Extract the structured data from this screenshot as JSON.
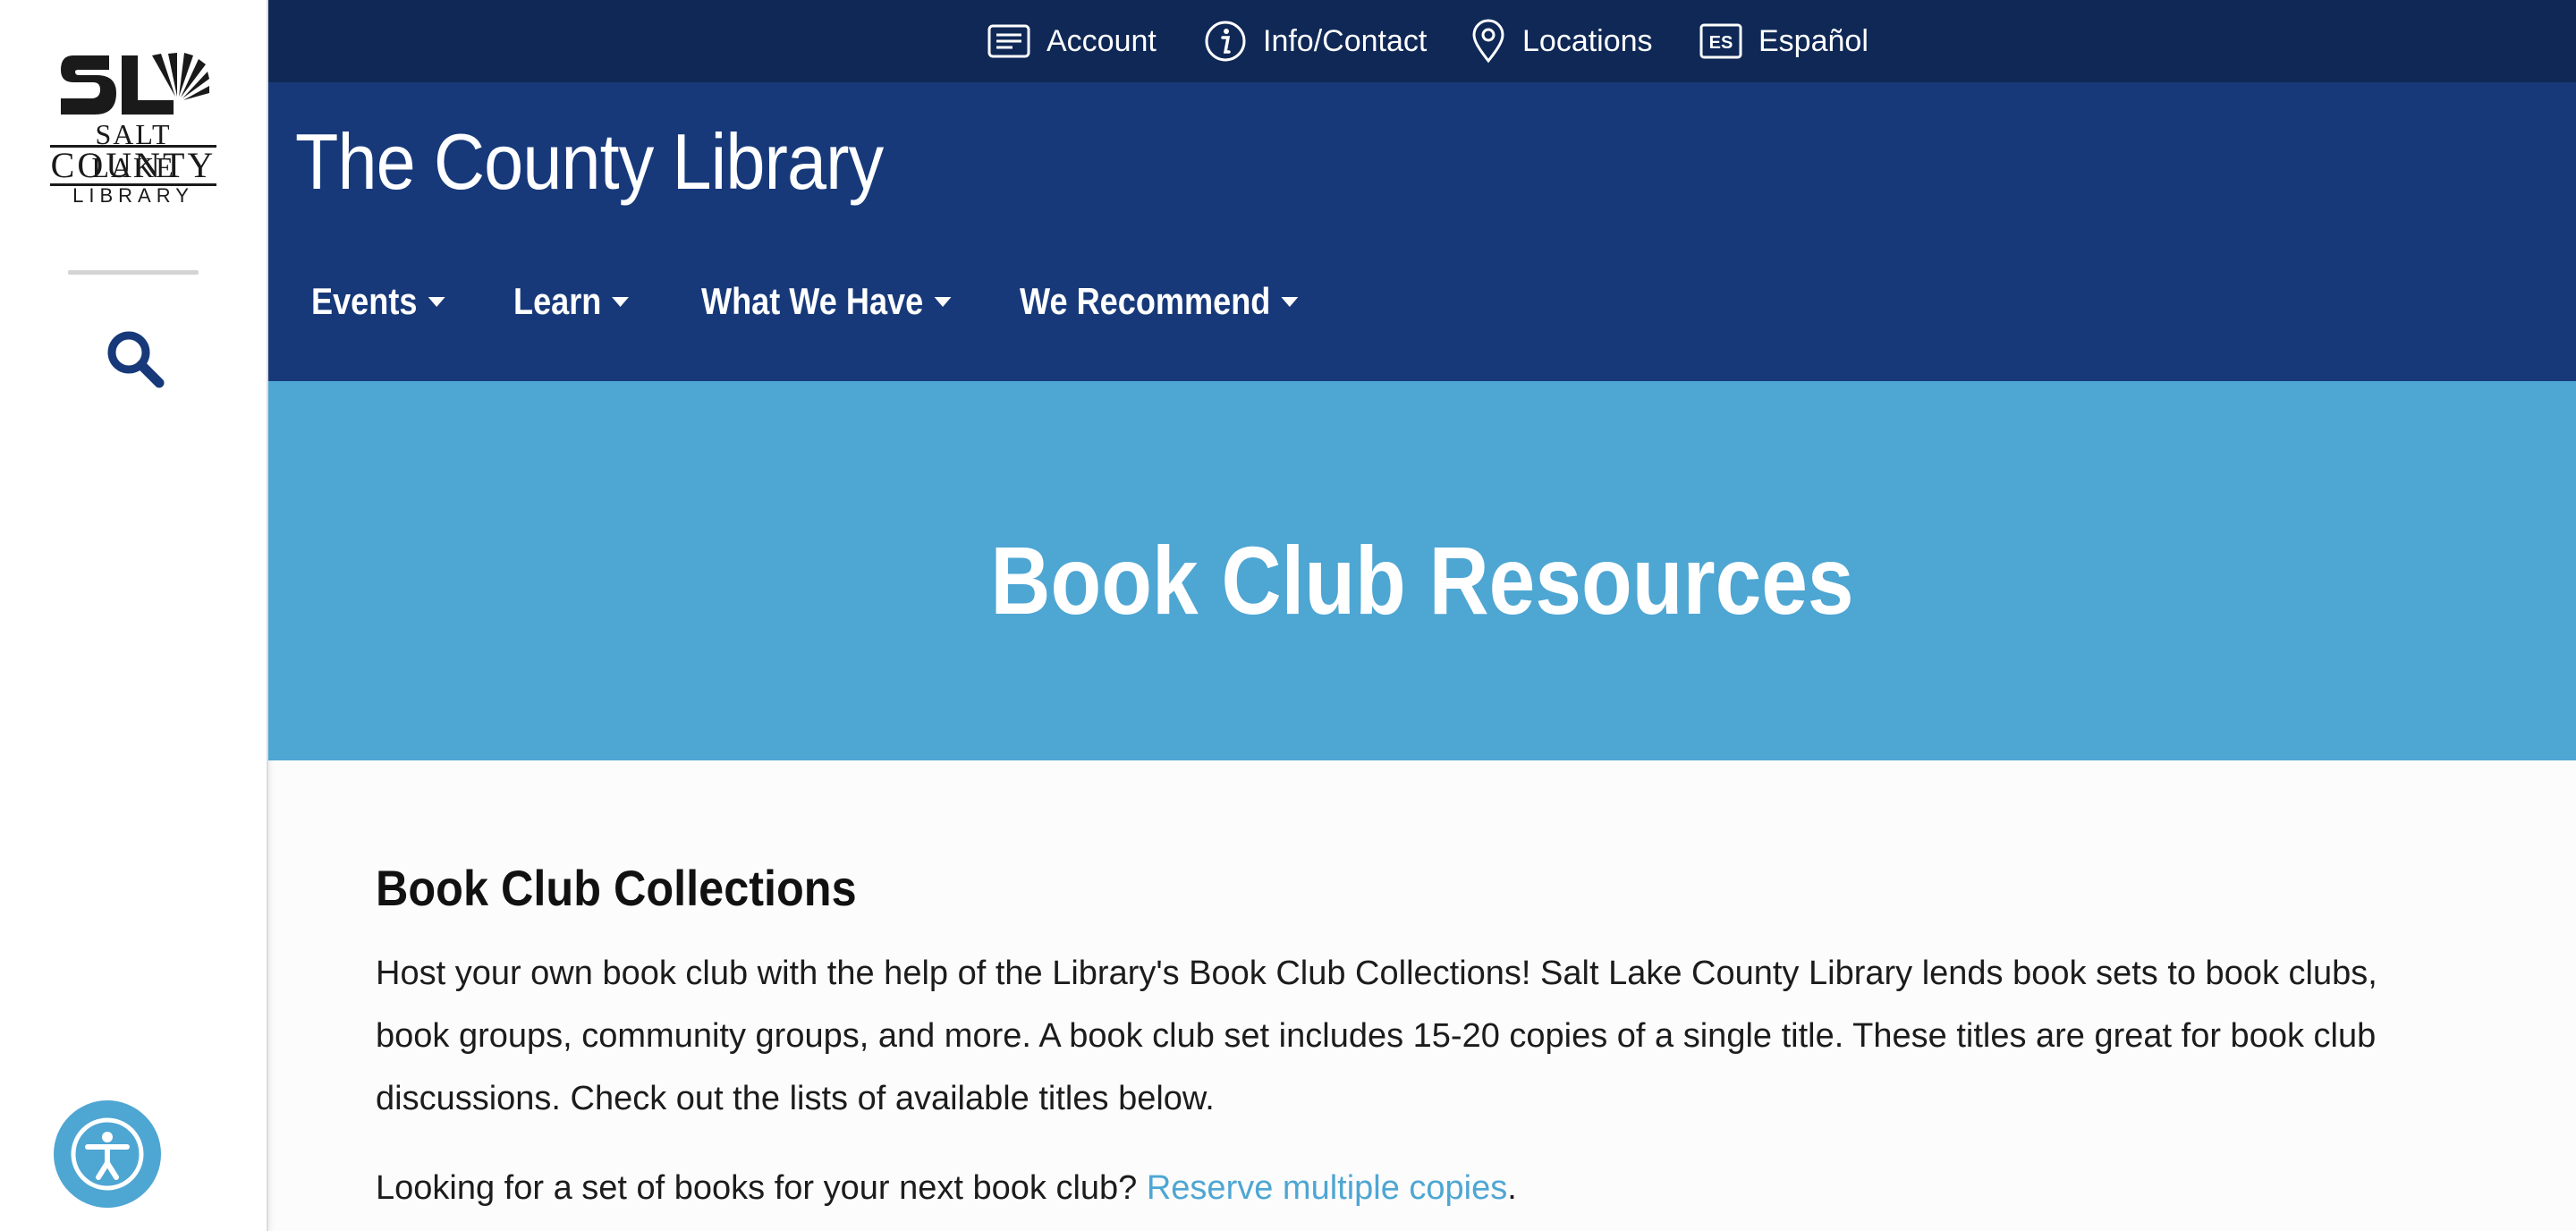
{
  "sidebar": {
    "logo": {
      "mark": "SL",
      "line1": "SALT LAKE",
      "line2": "COUNTY",
      "line3": "LIBRARY"
    },
    "search_icon": "search-icon",
    "accessibility_icon": "accessibility-icon"
  },
  "utility_nav": [
    {
      "label": "Account",
      "icon": "account-card-icon"
    },
    {
      "label": "Info/Contact",
      "icon": "info-icon"
    },
    {
      "label": "Locations",
      "icon": "location-pin-icon"
    },
    {
      "label": "Español",
      "icon": "es-badge-icon",
      "badge": "ES"
    }
  ],
  "header": {
    "site_title": "The County Library",
    "nav": [
      {
        "label": "Events"
      },
      {
        "label": "Learn"
      },
      {
        "label": "What We Have"
      },
      {
        "label": "We Recommend"
      }
    ]
  },
  "hero": {
    "title": "Book Club Resources"
  },
  "main": {
    "section_title": "Book Club Collections",
    "paragraph1": "Host your own book club with the help of the Library's Book Club Collections! Salt Lake County Library lends book sets to book clubs, book groups, community groups, and more. A book club set includes 15-20 copies of a single title. These titles are great for book club discussions. Check out the lists of available titles below.",
    "paragraph2_prefix": "Looking for a set of books for your next book club? ",
    "paragraph2_link": "Reserve multiple copies",
    "paragraph2_suffix": "."
  },
  "colors": {
    "utility_bar": "#0f2856",
    "header": "#17397a",
    "hero": "#4ea6d3",
    "link": "#4ea6d3",
    "search_icon": "#17397a"
  }
}
